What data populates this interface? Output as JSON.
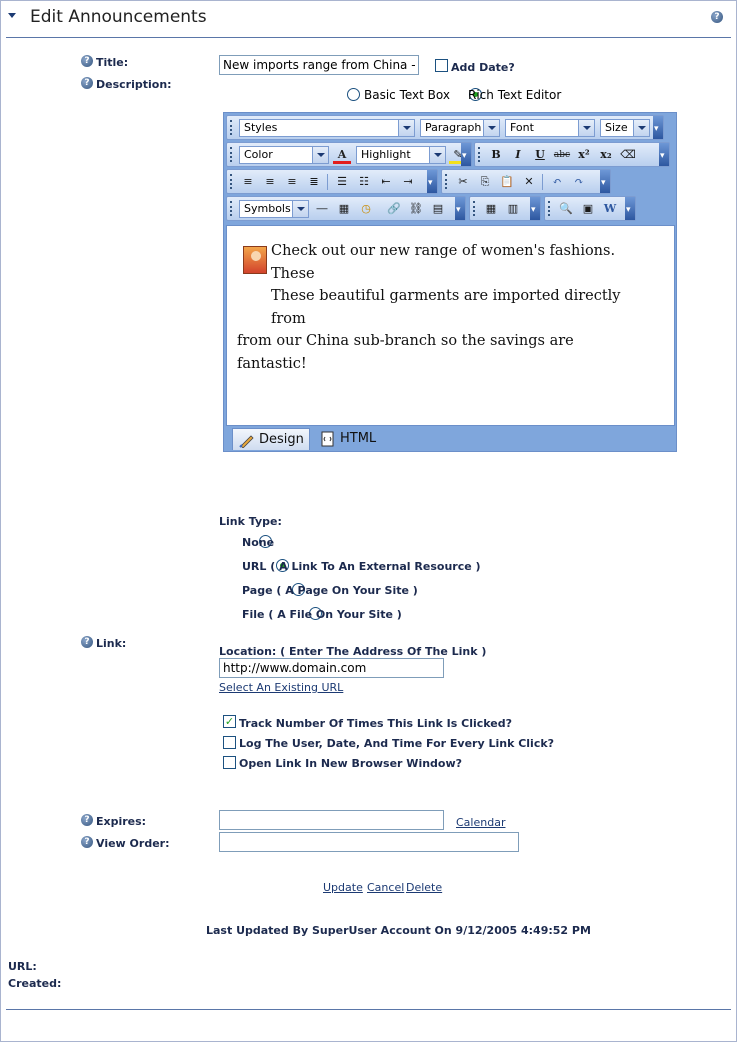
{
  "header": {
    "title": "Edit Announcements",
    "help": "?"
  },
  "form": {
    "title_label": "Title:",
    "title_value": "New imports range from China - Mo",
    "add_date_label": "Add Date?",
    "description_label": "Description:",
    "editor_mode": {
      "basic": "Basic Text Box",
      "rich": "Rich Text Editor"
    },
    "toolbar": {
      "styles": "Styles",
      "paragraph": "Paragraph",
      "font": "Font",
      "size": "Size",
      "color": "Color",
      "highlight": "Highlight",
      "symbols": "Symbols"
    },
    "editor_content": {
      "line1": "Check out our new range of women's fashions.  These",
      "line2": "These beautiful garments are imported directly from",
      "line3": "from our China sub-branch so the savings are",
      "line4": "fantastic!"
    },
    "editor_tabs": {
      "design": "Design",
      "html": "HTML"
    },
    "link_type_label": "Link Type:",
    "link_types": [
      {
        "label": "None",
        "selected": false
      },
      {
        "label": "URL ( A Link To An External Resource )",
        "selected": true
      },
      {
        "label": "Page ( A Page On Your Site )",
        "selected": false
      },
      {
        "label": "File ( A File On Your Site )",
        "selected": false
      }
    ],
    "link_label": "Link:",
    "location_label": "Location: ( Enter The Address Of The Link )",
    "location_value": "http://www.domain.com",
    "select_existing": "Select An Existing URL",
    "track_label": "Track Number Of Times This Link Is Clicked?",
    "log_label": "Log The User, Date, And Time For Every Link Click?",
    "newwindow_label": "Open Link In New Browser Window?",
    "expires_label": "Expires:",
    "calendar_link": "Calendar",
    "view_order_label": "View Order:"
  },
  "actions": {
    "update": "Update",
    "cancel": "Cancel",
    "delete": "Delete"
  },
  "footer": {
    "last_updated": "Last Updated By SuperUser Account On 9/12/2005 4:49:52 PM",
    "url_label": "URL:",
    "created_label": "Created:"
  }
}
